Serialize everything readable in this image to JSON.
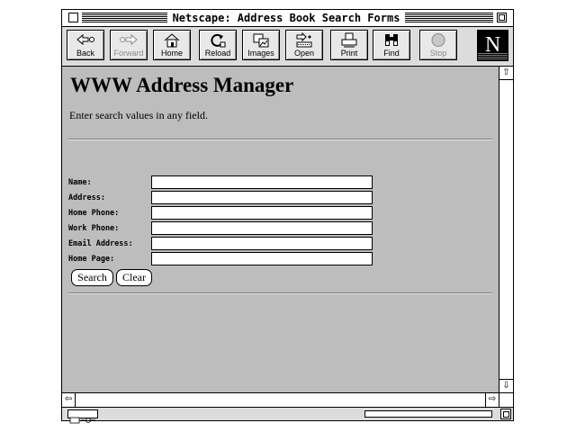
{
  "window": {
    "title": "Netscape: Address Book Search Forms"
  },
  "toolbar": {
    "buttons": [
      {
        "label": "Back",
        "icon": "back-arrow-icon",
        "enabled": true
      },
      {
        "label": "Forward",
        "icon": "forward-arrow-icon",
        "enabled": false
      },
      {
        "label": "Home",
        "icon": "home-icon",
        "enabled": true
      },
      {
        "label": "Reload",
        "icon": "reload-icon",
        "enabled": true
      },
      {
        "label": "Images",
        "icon": "images-icon",
        "enabled": true
      },
      {
        "label": "Open",
        "icon": "open-icon",
        "enabled": true
      },
      {
        "label": "Print",
        "icon": "printer-icon",
        "enabled": true
      },
      {
        "label": "Find",
        "icon": "binoculars-icon",
        "enabled": true
      },
      {
        "label": "Stop",
        "icon": "stop-icon",
        "enabled": false
      }
    ],
    "logo": "N"
  },
  "page": {
    "heading": "WWW Address Manager",
    "instructions": "Enter search values in any field."
  },
  "form": {
    "fields": [
      {
        "label": "Name:",
        "value": ""
      },
      {
        "label": "Address:",
        "value": ""
      },
      {
        "label": "Home Phone:",
        "value": ""
      },
      {
        "label": "Work Phone:",
        "value": ""
      },
      {
        "label": "Email Address:",
        "value": ""
      },
      {
        "label": "Home Page:",
        "value": ""
      }
    ],
    "search_label": "Search",
    "clear_label": "Clear"
  },
  "colors": {
    "content_background": "#bdbdbd",
    "toolbar_background": "#dcdcdc"
  }
}
